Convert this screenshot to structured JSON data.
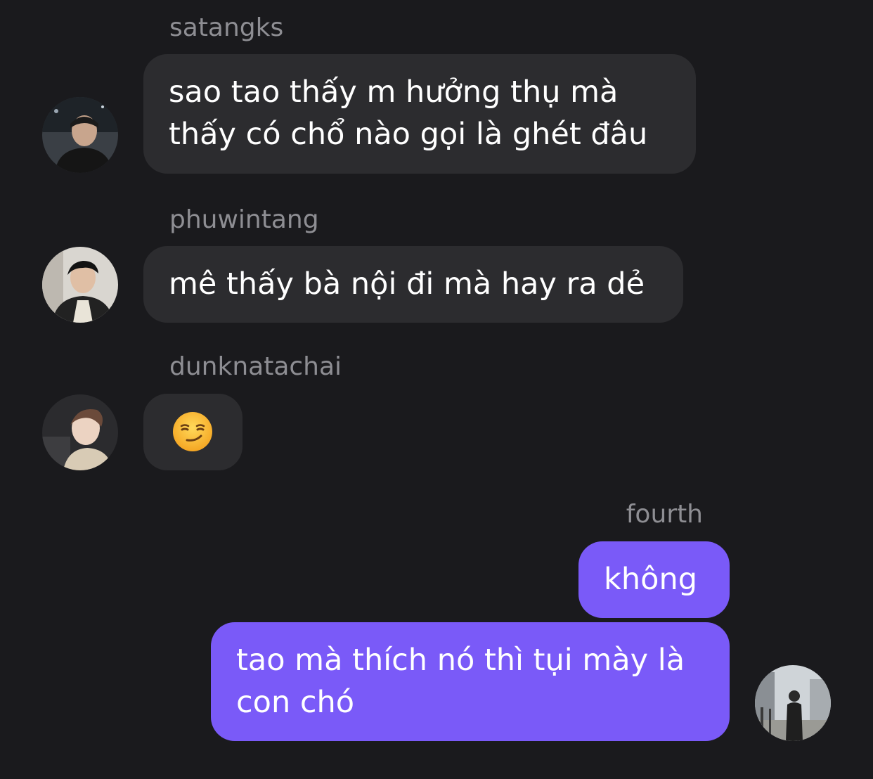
{
  "messages": [
    {
      "sender": "satangks",
      "lines": [
        "sao tao thấy m hưởng thụ mà",
        "thấy có chổ nào gọi là ghét đâu"
      ]
    },
    {
      "sender": "phuwintang",
      "lines": [
        "mê thấy bà nội đi mà hay ra dẻ"
      ]
    },
    {
      "sender": "dunknatachai",
      "emoji": "smirking-face-emoji"
    },
    {
      "sender": "fourth",
      "bubbles": [
        {
          "lines": [
            "không"
          ]
        },
        {
          "lines": [
            "tao mà thích nó thì tụi mày là",
            "con chó"
          ]
        }
      ]
    }
  ],
  "colors": {
    "background": "#1a1a1d",
    "incoming_bubble": "#2c2c2f",
    "outgoing_bubble": "#7a5af8",
    "username": "#8e8e93"
  }
}
